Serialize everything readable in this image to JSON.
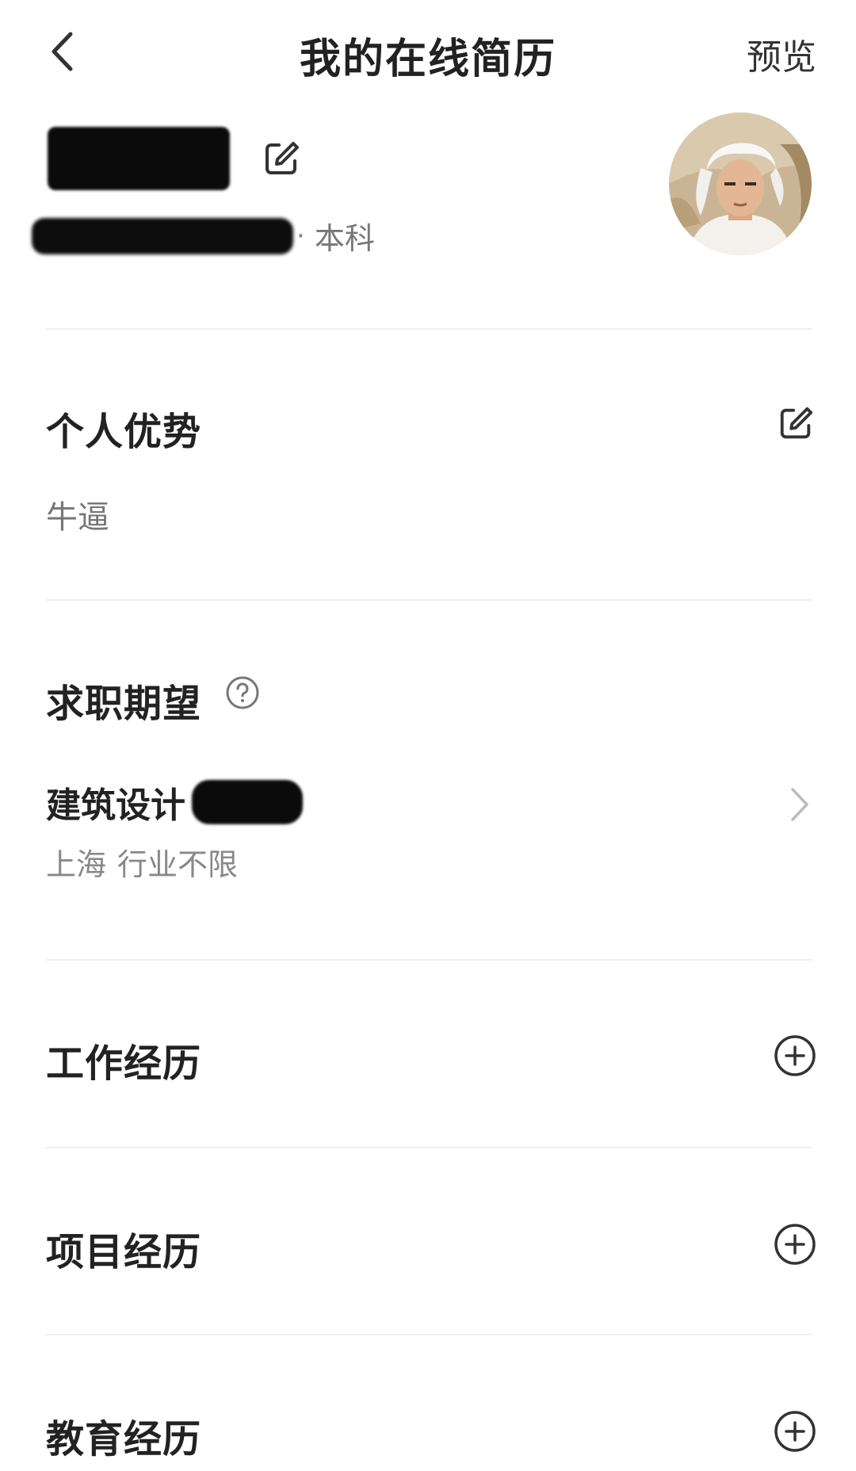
{
  "header": {
    "title": "我的在线简历",
    "preview_label": "预览"
  },
  "profile": {
    "name": "",
    "info_separator": "·",
    "degree": "本科"
  },
  "advantage": {
    "title": "个人优势",
    "text": "牛逼"
  },
  "expectation": {
    "title": "求职期望",
    "job": "建筑设计",
    "city": "上海",
    "industry": "行业不限"
  },
  "work": {
    "title": "工作经历"
  },
  "project": {
    "title": "项目经历"
  },
  "education": {
    "title": "教育经历"
  },
  "colors": {
    "text": "#222222",
    "secondary": "#888888",
    "divider": "#eeeeee"
  },
  "icons": {
    "back": "chevron-left-icon",
    "edit": "edit-icon",
    "help": "question-circle-icon",
    "add": "plus-circle-icon",
    "forward": "chevron-right-icon"
  }
}
